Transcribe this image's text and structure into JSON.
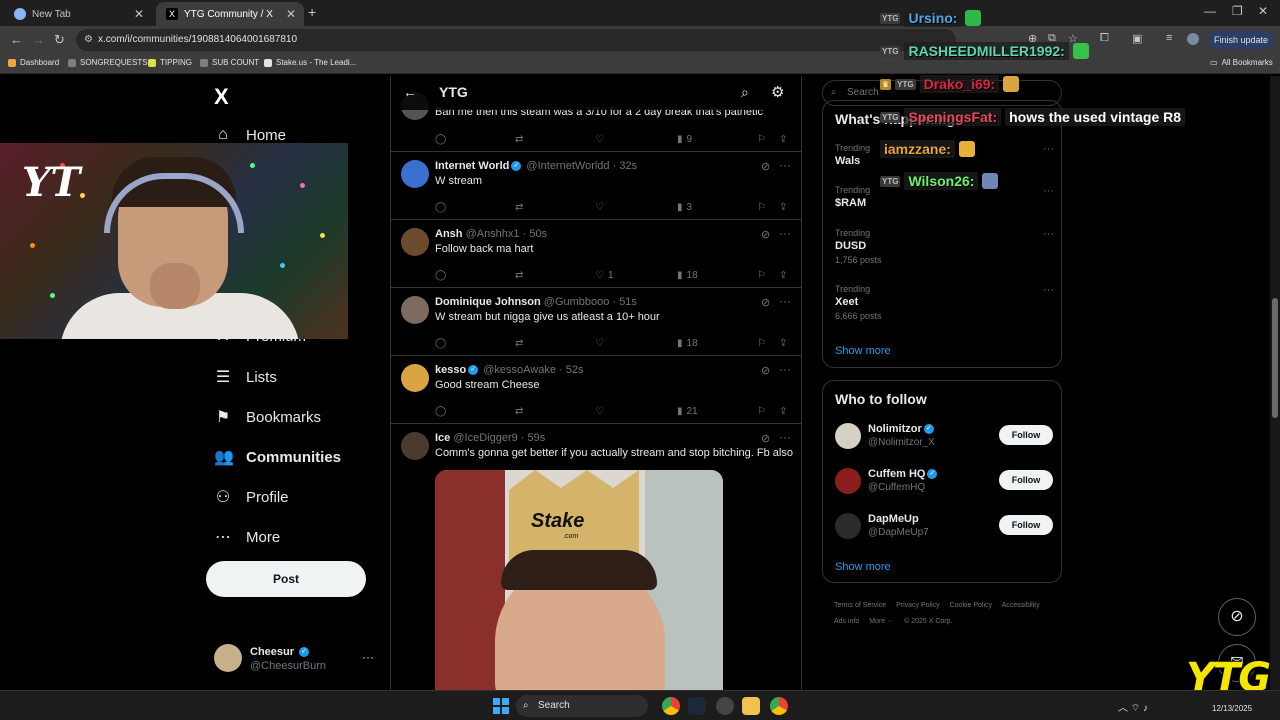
{
  "browser": {
    "tabs": [
      {
        "label": "New Tab"
      },
      {
        "label": "YTG Community / X"
      }
    ],
    "url": "x.com/i/communities/1908814064001687810",
    "finish_update": "Finish update",
    "bookmarks": [
      {
        "label": "Dashboard",
        "color": "#f2a33a"
      },
      {
        "label": "SONGREQUESTS",
        "color": "#7e7e7e"
      },
      {
        "label": "TIPPING",
        "color": "#d8e04a"
      },
      {
        "label": "SUB COUNT",
        "color": "#7e7e7e"
      },
      {
        "label": "Stake.us - The Leadi...",
        "color": "#e3e3e3"
      }
    ],
    "all_bookmarks": "All Bookmarks"
  },
  "left_nav": {
    "logo": "X",
    "items": [
      {
        "label": "Home",
        "icon": "home-icon",
        "glyph": "⌂"
      },
      {
        "label": "Premium",
        "icon": "x-premium-icon",
        "glyph": "X"
      },
      {
        "label": "Lists",
        "icon": "list-icon",
        "glyph": "☰"
      },
      {
        "label": "Bookmarks",
        "icon": "bookmark-icon",
        "glyph": "⚑"
      },
      {
        "label": "Communities",
        "icon": "people-icon",
        "glyph": "👥"
      },
      {
        "label": "Profile",
        "icon": "person-icon",
        "glyph": "⚇"
      },
      {
        "label": "More",
        "icon": "more-circle-icon",
        "glyph": "⋯"
      }
    ],
    "post_label": "Post",
    "account": {
      "name": "Cheesur",
      "handle": "@CheesurBurn"
    }
  },
  "community": {
    "title": "YTG"
  },
  "tweets": [
    {
      "name": "",
      "handle": "",
      "time": "",
      "text": "Ban me then this steam was a 3/10 for a 2 day break that's pathetic",
      "replies": "",
      "retweets": "",
      "likes": "",
      "views": "9",
      "avatar_color": "#555"
    },
    {
      "name": "Internet World",
      "verified": true,
      "handle": "@InternetWorldd",
      "time": "32s",
      "text": "W stream",
      "replies": "",
      "retweets": "",
      "likes": "",
      "views": "3",
      "avatar_color": "#3b6fd1"
    },
    {
      "name": "Ansh",
      "verified": false,
      "handle": "@Anshhx1",
      "time": "50s",
      "text": "Follow back ma hart",
      "replies": "",
      "retweets": "",
      "likes": "1",
      "views": "18",
      "avatar_color": "#6b4a2e"
    },
    {
      "name": "Dominique Johnson",
      "verified": false,
      "handle": "@Gumbbooo",
      "time": "51s",
      "text": "W stream but nigga give us atleast a 10+ hour",
      "replies": "",
      "retweets": "",
      "likes": "",
      "views": "18",
      "avatar_color": "#7d6a60"
    },
    {
      "name": "kesso",
      "verified": true,
      "handle": "@kessoAwake",
      "time": "52s",
      "text": "Good stream Cheese",
      "replies": "",
      "retweets": "",
      "likes": "",
      "views": "21",
      "avatar_color": "#d9a441"
    },
    {
      "name": "Ice",
      "verified": false,
      "handle": "@IceDigger9",
      "time": "59s",
      "text": "Comm's gonna get better if you actually stream and stop bitching. Fb also",
      "media_text": "Stake",
      "media_sub": ".com",
      "avatar_color": "#4a3a30"
    }
  ],
  "right": {
    "search_placeholder": "Search",
    "trends_title": "What's happening",
    "trends": [
      {
        "context": "Trending",
        "name": "Wals",
        "posts": ""
      },
      {
        "context": "Trending",
        "name": "$RAM",
        "posts": ""
      },
      {
        "context": "Trending",
        "name": "DUSD",
        "posts": "1,756 posts"
      },
      {
        "context": "Trending",
        "name": "Xeet",
        "posts": "6,666 posts"
      }
    ],
    "show_more": "Show more",
    "who_to_follow": "Who to follow",
    "follows": [
      {
        "name": "Nolimitzor",
        "handle": "@Nolimitzor_X",
        "verified": true,
        "avatar_color": "#d6d1c4"
      },
      {
        "name": "Cuffem HQ",
        "handle": "@CuffemHQ",
        "verified": true,
        "avatar_color": "#8a1d1d"
      },
      {
        "name": "DapMeUp",
        "handle": "@DapMeUp7",
        "verified": false,
        "avatar_color": "#2b2b2b"
      }
    ],
    "follow_label": "Follow",
    "footer": [
      "Terms of Service",
      "Privacy Policy",
      "Cookie Policy",
      "Accessibility",
      "Ads info",
      "More ···",
      "© 2025 X Corp."
    ]
  },
  "chat": [
    {
      "user": "Ursino:",
      "color": "#4ea8e6",
      "msg": "",
      "emote_color": "#2fb84a"
    },
    {
      "user": "RASHEEDMILLER1992:",
      "color": "#5ad8b0",
      "msg": "",
      "emote_color": "#36c14a"
    },
    {
      "user": "Drako_i69:",
      "color": "#e0243a",
      "msg": "",
      "emote_color": "#d9a441"
    },
    {
      "user": "SpeningsFat:",
      "color": "#e5495a",
      "msg": "hows the used vintage R8",
      "emote_color": ""
    },
    {
      "user": "iamzzane:",
      "color": "#e8a33a",
      "msg": "",
      "emote_color": "#e8b13a"
    },
    {
      "user": "Wilson26:",
      "color": "#6df06a",
      "msg": "",
      "emote_color": "#6c87b8"
    }
  ],
  "overlay": {
    "brand": "YTG"
  },
  "taskbar": {
    "search": "Search",
    "time": "",
    "date": "12/13/2025"
  }
}
